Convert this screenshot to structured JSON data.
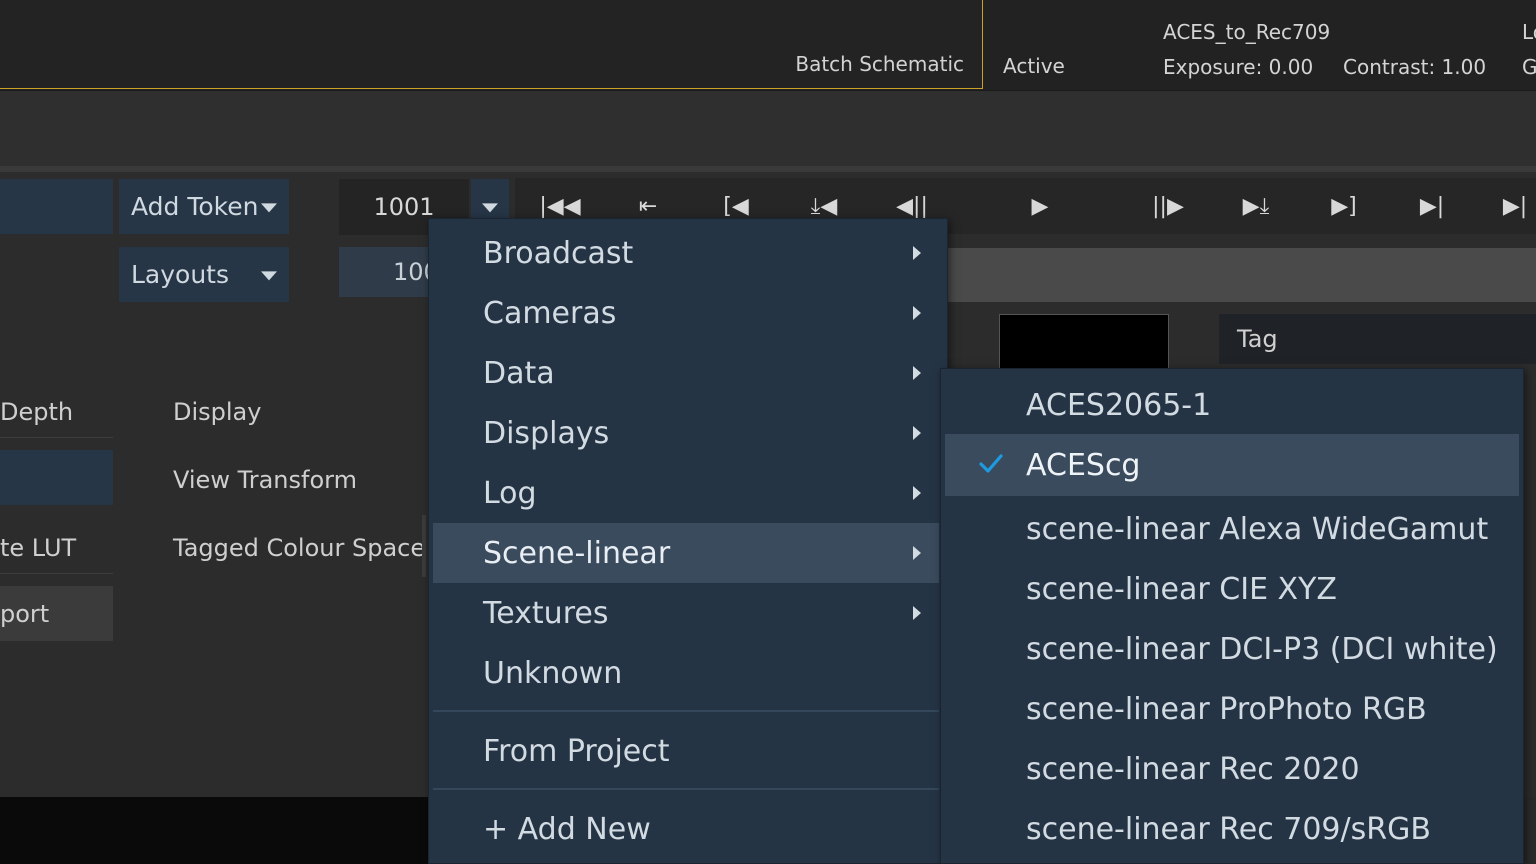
{
  "topbar": {
    "tab_label": "Batch Schematic",
    "status": "Active",
    "viewer_lut": "ACES_to_Rec709",
    "exposure": "Exposure: 0.00",
    "contrast": "Contrast: 1.00",
    "right_top_partial": "Lo",
    "right_bottom_partial": "G"
  },
  "controls": {
    "add_token": "Add Token",
    "layouts": "Layouts",
    "frame_start": "1001",
    "frame_end_partial": "100",
    "left_labels": [
      "Depth",
      "te LUT",
      "port"
    ],
    "mid_labels": [
      "Display",
      "View Transform",
      "Tagged Colour Space"
    ],
    "tag_header": "Tag"
  },
  "transport": {
    "buttons": [
      "|◀◀",
      "⇤",
      "[◀",
      "⤓◀",
      "◀||",
      "▶",
      "||▶",
      "▶⤓",
      "▶]",
      "▶|",
      "▶|"
    ]
  },
  "menu": {
    "items": [
      {
        "label": "Broadcast",
        "submenu": true
      },
      {
        "label": "Cameras",
        "submenu": true
      },
      {
        "label": "Data",
        "submenu": true
      },
      {
        "label": "Displays",
        "submenu": true
      },
      {
        "label": "Log",
        "submenu": true
      },
      {
        "label": "Scene-linear",
        "submenu": true,
        "active": true
      },
      {
        "label": "Textures",
        "submenu": true
      },
      {
        "label": "Unknown",
        "submenu": false
      }
    ],
    "from_project": "From Project",
    "add_new": "+ Add New"
  },
  "submenu": {
    "items": [
      {
        "label": "ACES2065-1",
        "selected": false
      },
      {
        "label": "ACEScg",
        "selected": true
      },
      {
        "label": "scene-linear Alexa WideGamut",
        "selected": false
      },
      {
        "label": "scene-linear CIE XYZ",
        "selected": false
      },
      {
        "label": "scene-linear DCI-P3 (DCI white)",
        "selected": false
      },
      {
        "label": "scene-linear ProPhoto RGB",
        "selected": false
      },
      {
        "label": "scene-linear Rec 2020",
        "selected": false
      },
      {
        "label": "scene-linear Rec 709/sRGB",
        "selected": false
      }
    ]
  },
  "colors": {
    "accent_gold": "#c9a227",
    "menu_bg": "#253445",
    "check_color": "#1e9be0"
  }
}
